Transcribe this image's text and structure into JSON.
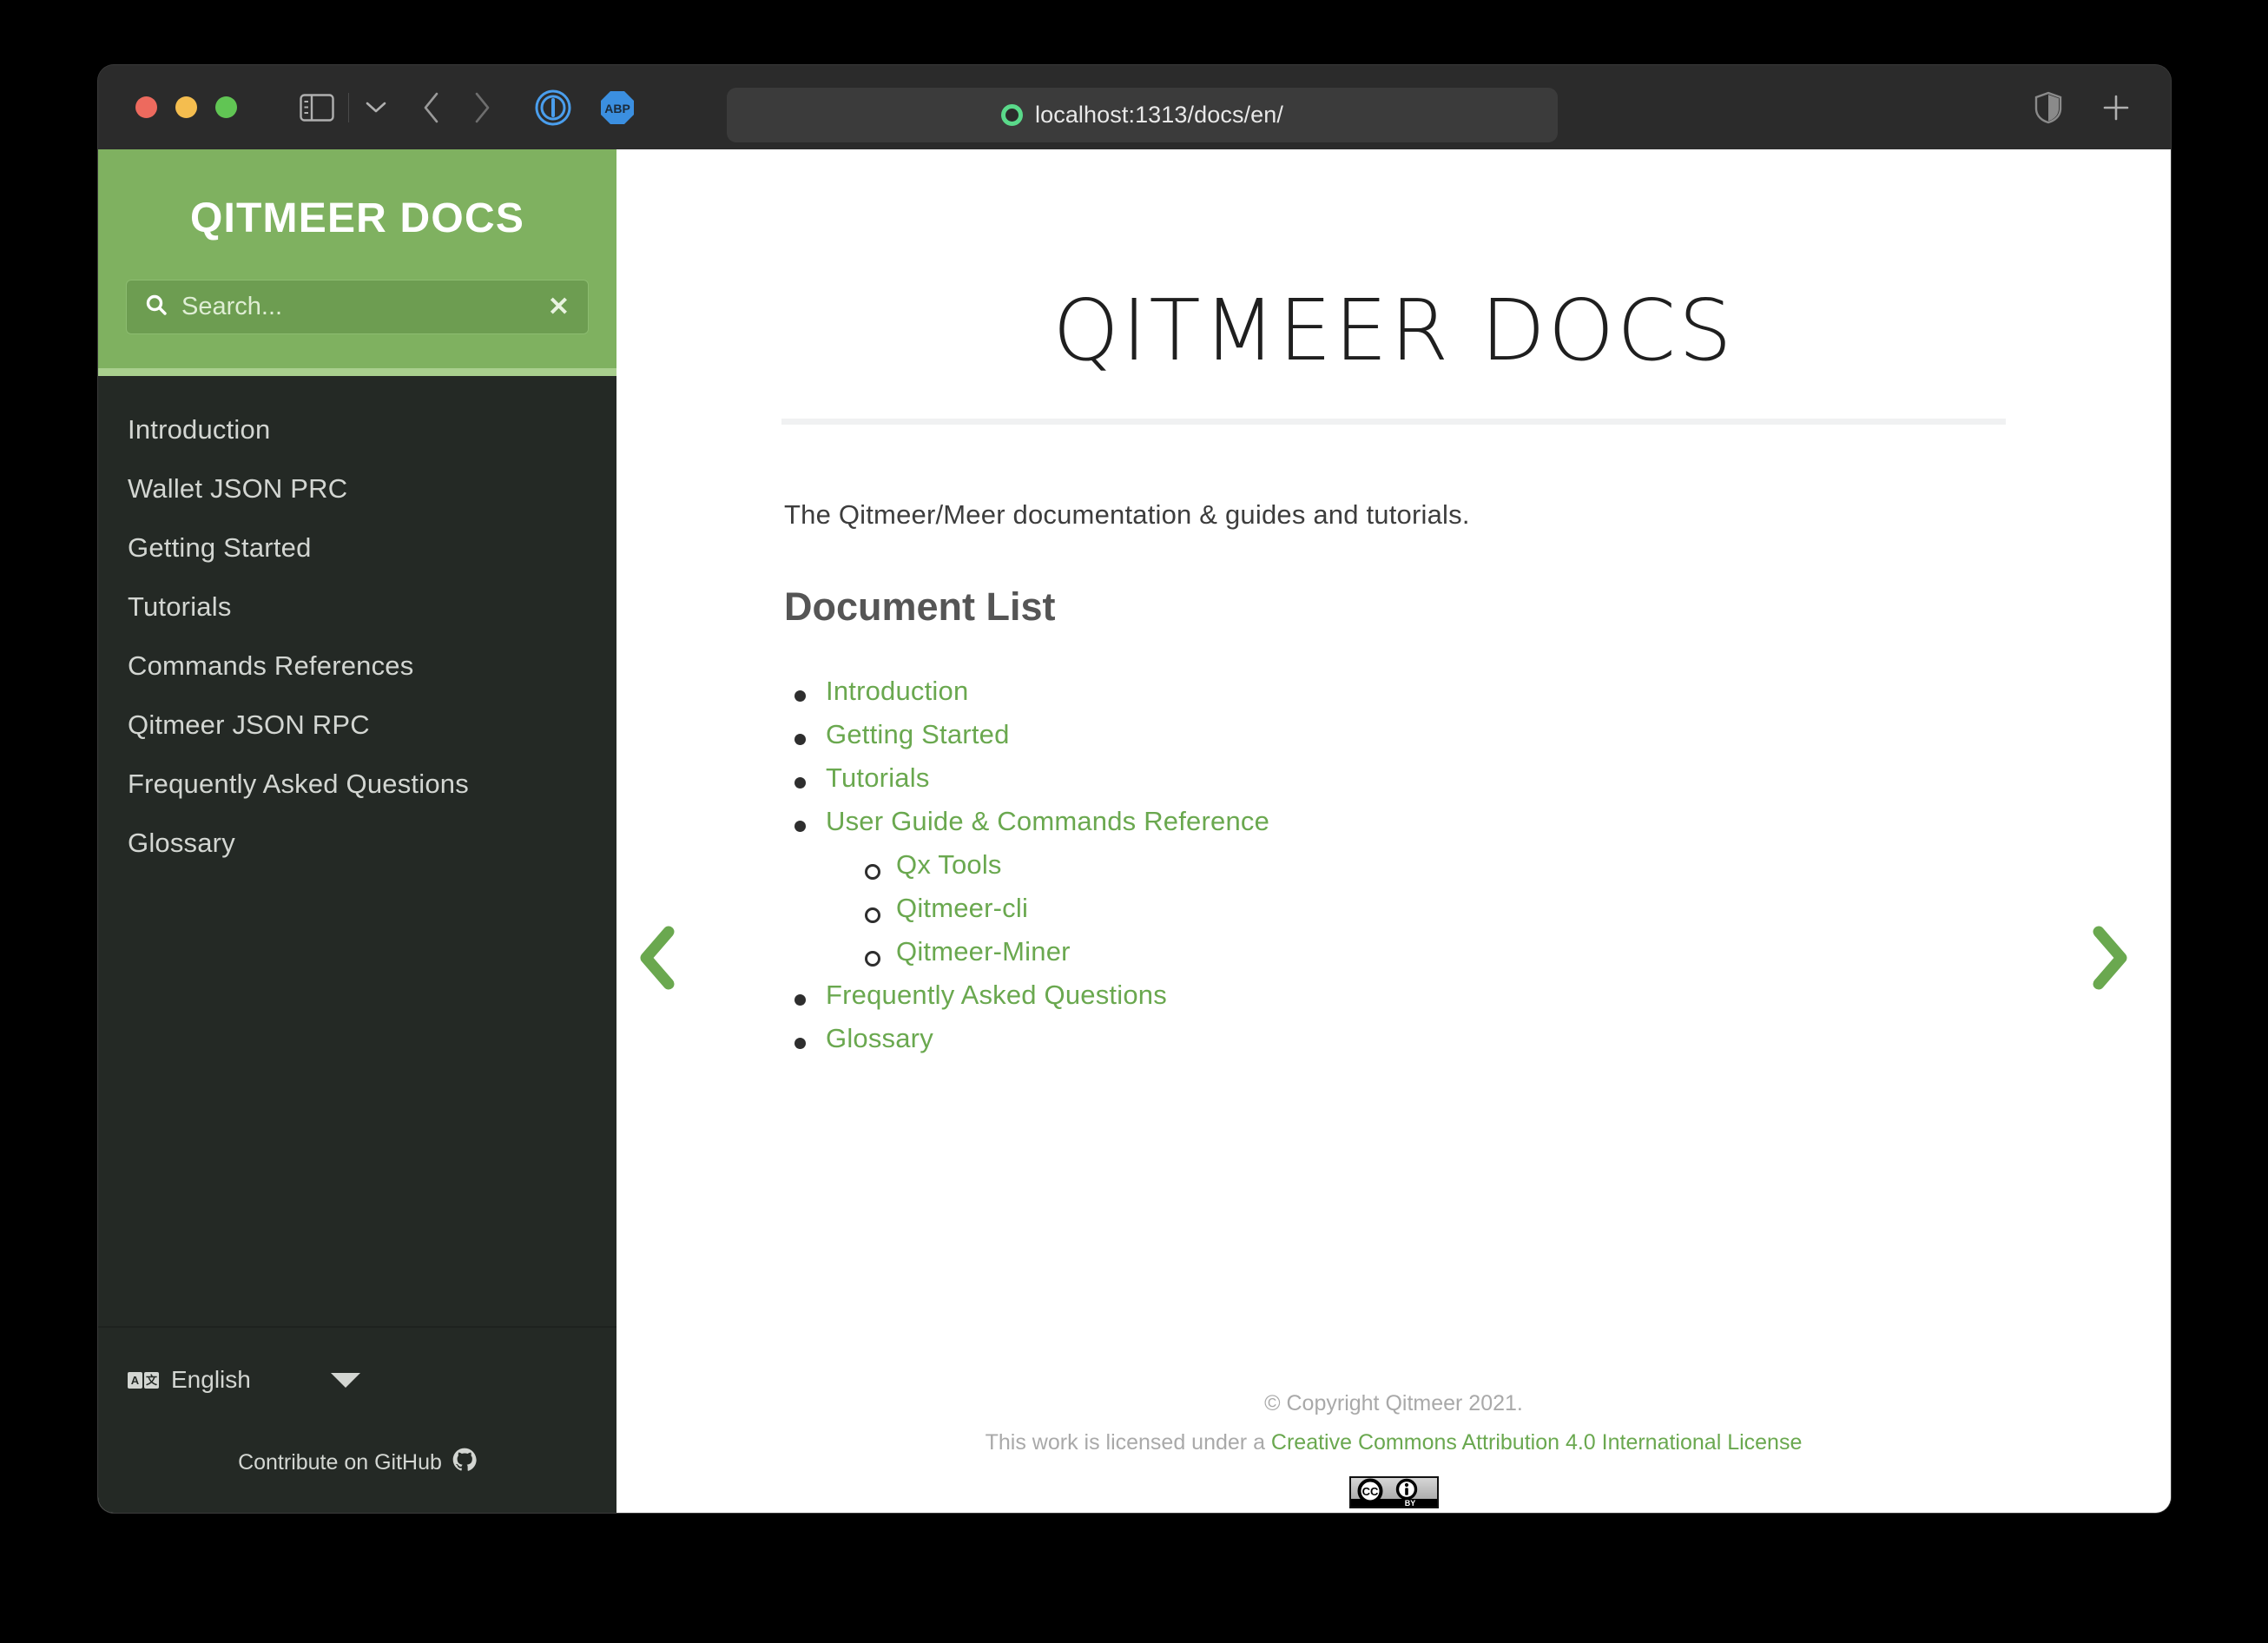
{
  "browser": {
    "traffic_lights": [
      "close",
      "minimize",
      "zoom"
    ],
    "sidebar_toggle_icon": "sidebar-icon",
    "sidebar_dropdown_icon": "chevron-down-icon",
    "back_icon": "chevron-left-icon",
    "forward_icon": "chevron-right-icon",
    "onepassword_icon": "1password-icon",
    "adblock_icon": "adblock-plus-icon",
    "adblock_label": "ABP",
    "address_bar": {
      "url": "localhost:1313/docs/en/",
      "favicon_icon": "qitmeer-favicon-icon",
      "favicon_color": "#5ad98a"
    },
    "privacy_report_icon": "shield-icon",
    "new_tab_icon": "plus-icon"
  },
  "sidebar": {
    "title": "QITMEER DOCS",
    "header_color": "#7fb160",
    "accent_color": "#a9cf8e",
    "background_color": "#242925",
    "search": {
      "placeholder": "Search...",
      "search_icon": "search-icon",
      "clear_icon": "close-icon",
      "clear_label": "✕"
    },
    "items": [
      {
        "label": "Introduction"
      },
      {
        "label": "Wallet JSON PRC"
      },
      {
        "label": "Getting Started"
      },
      {
        "label": "Tutorials"
      },
      {
        "label": "Commands References"
      },
      {
        "label": "Qitmeer JSON RPC"
      },
      {
        "label": "Frequently Asked Questions"
      },
      {
        "label": "Glossary"
      }
    ],
    "language_selector": {
      "icon": "translate-icon",
      "icon_left_glyph": "A",
      "icon_right_glyph": "文",
      "label": "English",
      "caret_icon": "caret-down-icon"
    },
    "github": {
      "label": "Contribute on GitHub",
      "icon": "github-icon"
    }
  },
  "main": {
    "heading": "QITMEER DOCS",
    "intro": "The Qitmeer/Meer documentation & guides and tutorials.",
    "section_heading": "Document List",
    "link_color": "#6aa84f",
    "document_list": [
      {
        "label": "Introduction"
      },
      {
        "label": "Getting Started"
      },
      {
        "label": "Tutorials"
      },
      {
        "label": "User Guide & Commands Reference",
        "children": [
          {
            "label": "Qx Tools"
          },
          {
            "label": "Qitmeer-cli"
          },
          {
            "label": "Qitmeer-Miner"
          }
        ]
      },
      {
        "label": "Frequently Asked Questions"
      },
      {
        "label": "Glossary"
      }
    ],
    "prev_arrow_icon": "chevron-left-icon",
    "next_arrow_icon": "chevron-right-icon"
  },
  "footer": {
    "copyright": "© Copyright Qitmeer 2021.",
    "license_prefix": "This work is licensed under a ",
    "license_link": "Creative Commons Attribution 4.0 International License",
    "cc_badge": {
      "icon": "creative-commons-by-badge-icon",
      "cc_label": "CC",
      "by_label": "BY"
    }
  }
}
